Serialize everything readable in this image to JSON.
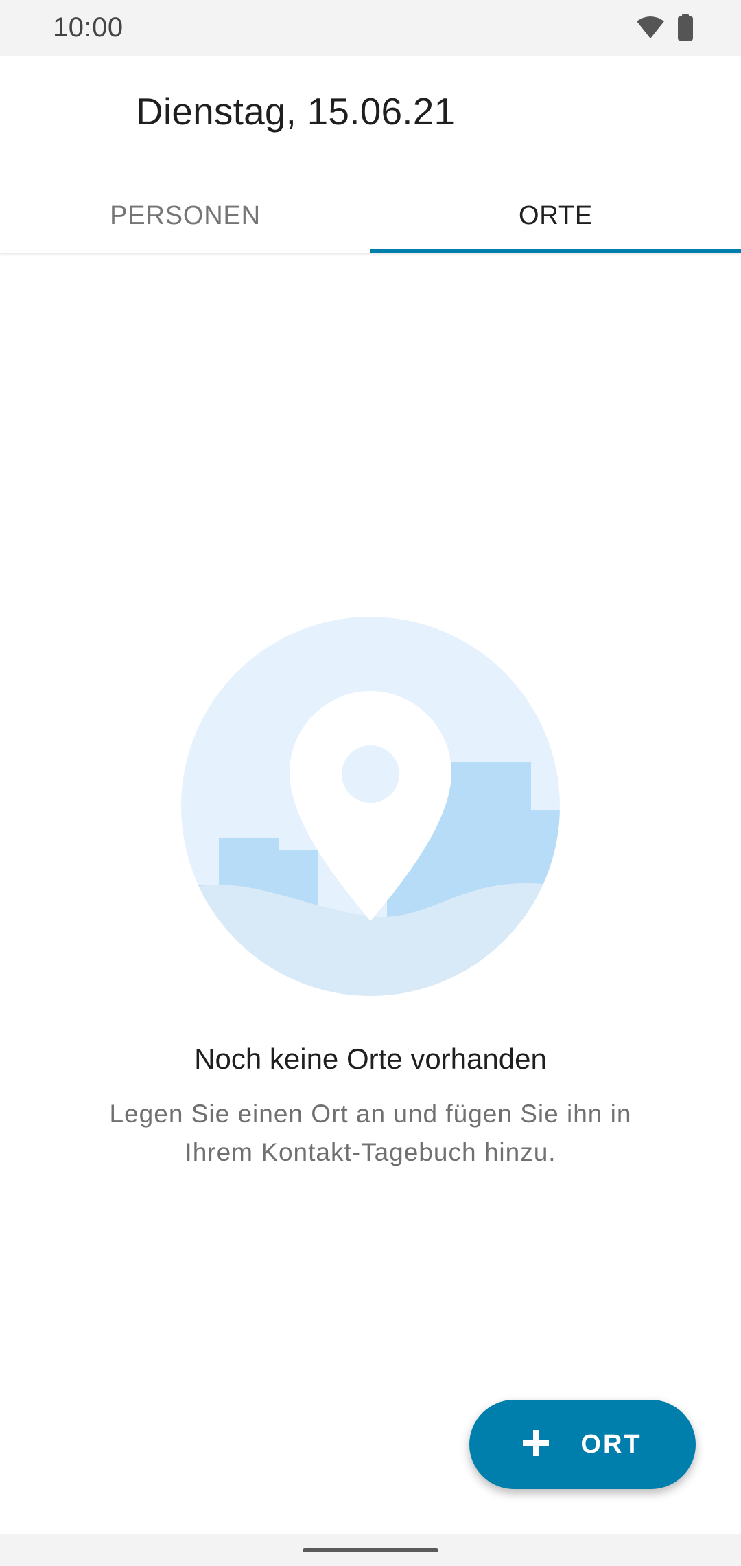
{
  "status_bar": {
    "time": "10:00",
    "icons": [
      "wifi-icon",
      "battery-icon"
    ]
  },
  "header": {
    "title": "Dienstag, 15.06.21"
  },
  "tabs": [
    {
      "label": "PERSONEN",
      "active": false
    },
    {
      "label": "ORTE",
      "active": true
    }
  ],
  "empty_state": {
    "illustration": "location-pin-icon",
    "title": "Noch keine Orte vorhanden",
    "description": "Legen Sie einen Ort an und fügen Sie ihn in Ihrem Kontakt-Tagebuch hinzu."
  },
  "fab": {
    "icon": "plus-icon",
    "label": "ORT"
  },
  "colors": {
    "accent": "#007fad",
    "illustration_light": "#e5f2fd",
    "illustration_mid": "#b7dcf7",
    "illustration_ground": "#d8eaf7"
  }
}
